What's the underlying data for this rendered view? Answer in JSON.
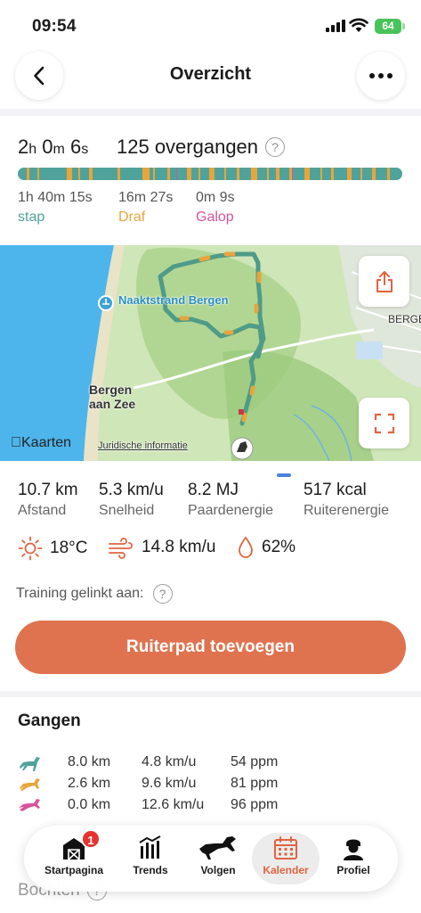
{
  "status": {
    "time": "09:54",
    "battery": "64"
  },
  "nav": {
    "title": "Overzicht"
  },
  "summary": {
    "duration": {
      "h": "2",
      "h_unit": "h",
      "m": "0",
      "m_unit": "m",
      "s": "6",
      "s_unit": "s"
    },
    "transitions": "125 overgangen",
    "gaits": [
      {
        "time": "1h 40m 15s",
        "label": "stap",
        "color": "#4fa39b"
      },
      {
        "time": "16m 27s",
        "label": "Draf",
        "color": "#e9a43c"
      },
      {
        "time": "0m 9s",
        "label": "Galop",
        "color": "#d9539b"
      }
    ]
  },
  "map": {
    "labels": {
      "naaktstrand": "Naaktstrand Bergen",
      "bergen_aan_zee": "Bergen aan Zee",
      "bergen": "BERGE",
      "kaarten": "Kaarten",
      "juridisch": "Juridische informatie"
    },
    "icons": [
      "share-icon",
      "fullscreen-icon"
    ]
  },
  "stats": [
    {
      "value": "10.7 km",
      "label": "Afstand"
    },
    {
      "value": "5.3 km/u",
      "label": "Snelheid"
    },
    {
      "value": "8.2 MJ",
      "label": "Paardenergie"
    },
    {
      "value": "517 kcal",
      "label": "Ruiterenergie"
    }
  ],
  "weather": {
    "temp": "18°C",
    "wind": "14.8 km/u",
    "humidity": "62%"
  },
  "linked": {
    "label": "Training gelinkt aan:"
  },
  "cta": {
    "label": "Ruiterpad toevoegen"
  },
  "gangen": {
    "title": "Gangen",
    "rows": [
      {
        "gait": "stap",
        "color": "#4fa39b",
        "distance": "8.0 km",
        "speed": "4.8 km/u",
        "cadence": "54 ppm"
      },
      {
        "gait": "Draf",
        "color": "#e9a43c",
        "distance": "2.6 km",
        "speed": "9.6 km/u",
        "cadence": "81 ppm"
      },
      {
        "gait": "Galop",
        "color": "#d9539b",
        "distance": "0.0 km",
        "speed": "12.6 km/u",
        "cadence": "96 ppm"
      }
    ],
    "next_section": "Bochten"
  },
  "tabbar": {
    "items": [
      {
        "label": "Startpagina",
        "icon": "barn-icon",
        "badge": "1"
      },
      {
        "label": "Trends",
        "icon": "trends-icon"
      },
      {
        "label": "Volgen",
        "icon": "horse-icon"
      },
      {
        "label": "Kalender",
        "icon": "calendar-icon",
        "active": true
      },
      {
        "label": "Profiel",
        "icon": "profile-icon"
      }
    ]
  }
}
